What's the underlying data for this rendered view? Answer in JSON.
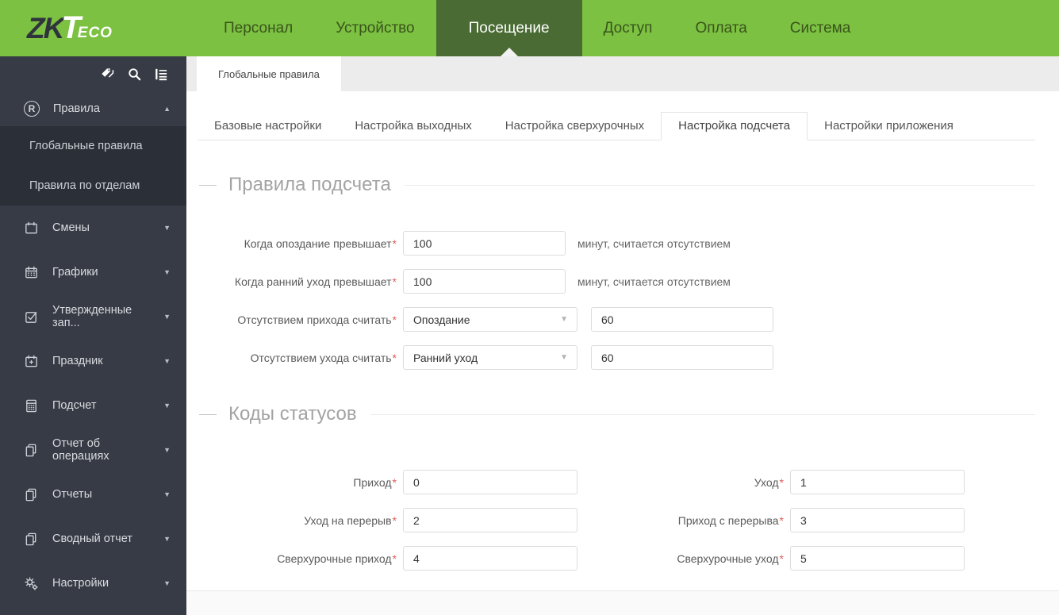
{
  "colors": {
    "brand_green": "#7cc142",
    "nav_active_bg": "#4a6b33",
    "sidebar_bg": "#373b45",
    "sidebar_active_bg": "#2b2f38",
    "required_red": "#e05c5c"
  },
  "logo": {
    "zk": "ZK",
    "t": "T",
    "eco": "ECO"
  },
  "nav": {
    "items": [
      "Персонал",
      "Устройство",
      "Посещение",
      "Доступ",
      "Оплата",
      "Система"
    ],
    "active": "Посещение"
  },
  "sidebar": {
    "tool_icons": [
      "tag-icon",
      "search-icon",
      "list-panel-icon"
    ],
    "rules": {
      "label": "Правила",
      "caret": "▲",
      "state": "expanded"
    },
    "submenu": [
      {
        "label": "Глобальные правила"
      },
      {
        "label": "Правила по отделам"
      }
    ],
    "items": [
      {
        "label": "Смены",
        "icon": "calendar-icon",
        "caret": "▼"
      },
      {
        "label": "Графики",
        "icon": "calendar-grid-icon",
        "caret": "▼"
      },
      {
        "label": "Утвержденные зап...",
        "icon": "checkbox-icon",
        "caret": "▼"
      },
      {
        "label": "Праздник",
        "icon": "calendar-plus-icon",
        "caret": "▼"
      },
      {
        "label": "Подсчет",
        "icon": "calculator-icon",
        "caret": "▼"
      },
      {
        "label": "Отчет об операциях",
        "icon": "report-pages-icon",
        "caret": "▼"
      },
      {
        "label": "Отчеты",
        "icon": "report-pages-icon",
        "caret": "▼"
      },
      {
        "label": "Сводный отчет",
        "icon": "report-pages-icon",
        "caret": "▼"
      },
      {
        "label": "Настройки",
        "icon": "gears-icon",
        "caret": "▼"
      }
    ]
  },
  "page_tabs": {
    "active": "Глобальные правила"
  },
  "subtabs": {
    "items": [
      "Базовые настройки",
      "Настройка выходных",
      "Настройка сверхурочных",
      "Настройка подсчета",
      "Настройки приложения"
    ],
    "active": "Настройка подсчета"
  },
  "calc_rules": {
    "title": "Правила подсчета",
    "rows": [
      {
        "label": "Когда опоздание превышает",
        "value": "100",
        "suffix": "минут, считается отсутствием"
      },
      {
        "label": "Когда ранний уход превышает",
        "value": "100",
        "suffix": "минут, считается отсутствием"
      },
      {
        "label": "Отсутствием прихода считать",
        "select": "Опоздание",
        "value": "60"
      },
      {
        "label": "Отсутствием ухода считать",
        "select": "Ранний уход",
        "value": "60"
      }
    ],
    "select_caret": "▼"
  },
  "status_codes": {
    "title": "Коды статусов",
    "rows": [
      {
        "left_label": "Приход",
        "left_value": "0",
        "right_label": "Уход",
        "right_value": "1"
      },
      {
        "left_label": "Уход на перерыв",
        "left_value": "2",
        "right_label": "Приход с перерыва",
        "right_value": "3"
      },
      {
        "left_label": "Сверхурочные приход",
        "left_value": "4",
        "right_label": "Сверхурочные уход",
        "right_value": "5"
      }
    ]
  }
}
